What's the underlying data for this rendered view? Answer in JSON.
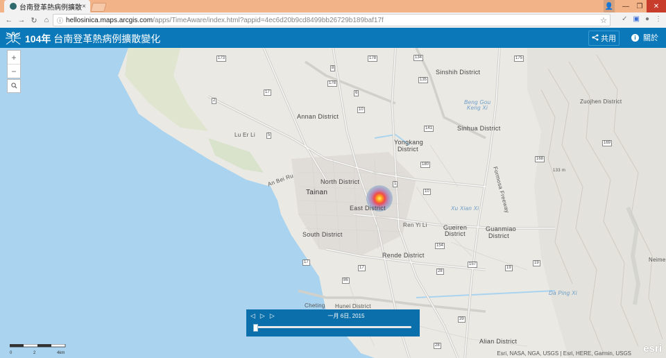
{
  "browser": {
    "tab_title": "台南登革熱病例擴散變化",
    "tab_close": "×",
    "url_host": "hellosinica.maps.arcgis.com",
    "url_path": "/apps/TimeAware/index.html?appid=4ec6d20b9cd8499bb26729b189baf17f"
  },
  "header": {
    "title_prefix": "104年",
    "title_main": "台南登革熱病例擴散變化",
    "share_label": "共用",
    "about_label": "關於"
  },
  "map": {
    "zoom_in": "+",
    "zoom_out": "−",
    "labels": {
      "sinshih": "Sinshih District",
      "annan": "Annan District",
      "bengou": "Beng Gou",
      "kengxi": "Keng Xi",
      "sinhua": "Sinhua District",
      "yongkang": "Yongkang",
      "yongkang2": "District",
      "zuojhen": "Zuojhen District",
      "luerli": "Lu Er Li",
      "anbeiru": "An Bei Ru",
      "north": "North District",
      "tainan": "Tainan",
      "east": "East District",
      "formosa": "Formosa Freeway",
      "xuxianxi": "Xu Xian Xi",
      "renyili": "Ren Yi Li",
      "gueiren": "Gueiren",
      "gueiren2": "District",
      "guanmiao": "Guanmiao",
      "guanmiao2": "District",
      "south": "South District",
      "rende": "Rende District",
      "neimen": "Neime",
      "dapingxi": "Da Ping Xi",
      "cheting": "Cheting",
      "hunei": "Hunei District",
      "alian": "Alian District",
      "peak": "133 m"
    },
    "shields": [
      "173",
      "178",
      "134",
      "175",
      "8",
      "17",
      "178",
      "135",
      "2",
      "6",
      "10",
      "141",
      "5",
      "180",
      "169",
      "168",
      "1",
      "10",
      "154",
      "157",
      "17",
      "19",
      "86",
      "28",
      "39",
      "17",
      "19",
      "28"
    ]
  },
  "timeslider": {
    "date": "一月 6日, 2015"
  },
  "scalebar": {
    "labels": [
      "0",
      "2",
      "4km"
    ]
  },
  "attribution": "Esri, NASA, NGA, USGS | Esri, HERE, Garmin, USGS",
  "esri_logo": "esri"
}
